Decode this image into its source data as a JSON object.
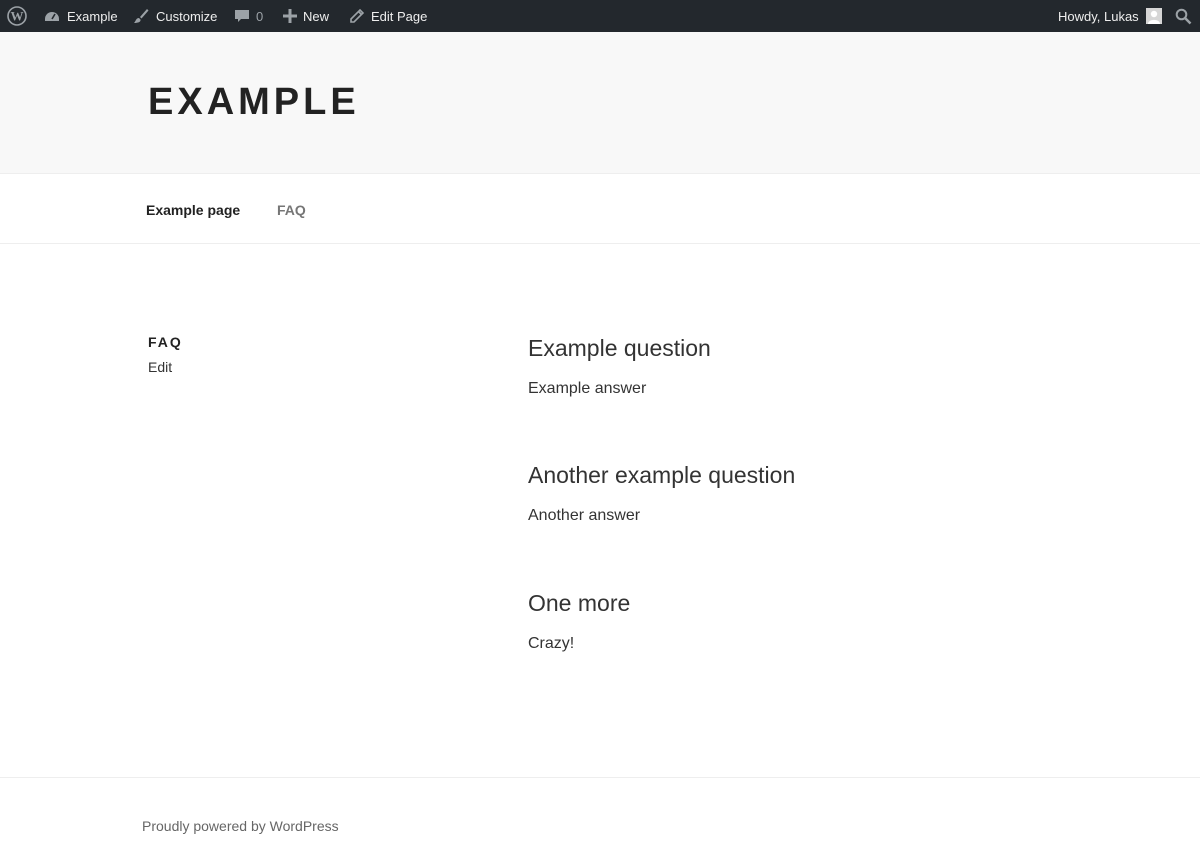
{
  "adminbar": {
    "site_name": "Example",
    "customize": "Customize",
    "comments_count": "0",
    "new": "New",
    "edit_page": "Edit Page",
    "howdy": "Howdy, Lukas"
  },
  "header": {
    "site_title": "EXAMPLE"
  },
  "nav": {
    "items": [
      {
        "label": "Example page"
      },
      {
        "label": "FAQ"
      }
    ]
  },
  "page": {
    "title": "FAQ",
    "edit_label": "Edit",
    "faq": [
      {
        "question": "Example question",
        "answer": "Example answer"
      },
      {
        "question": "Another example question",
        "answer": "Another answer"
      },
      {
        "question": "One more",
        "answer": "Crazy!"
      }
    ]
  },
  "footer": {
    "powered_by": "Proudly powered by WordPress"
  },
  "colors": {
    "adminbar_bg": "#23282d",
    "header_bg": "#f8f8f8",
    "text": "#333333"
  }
}
